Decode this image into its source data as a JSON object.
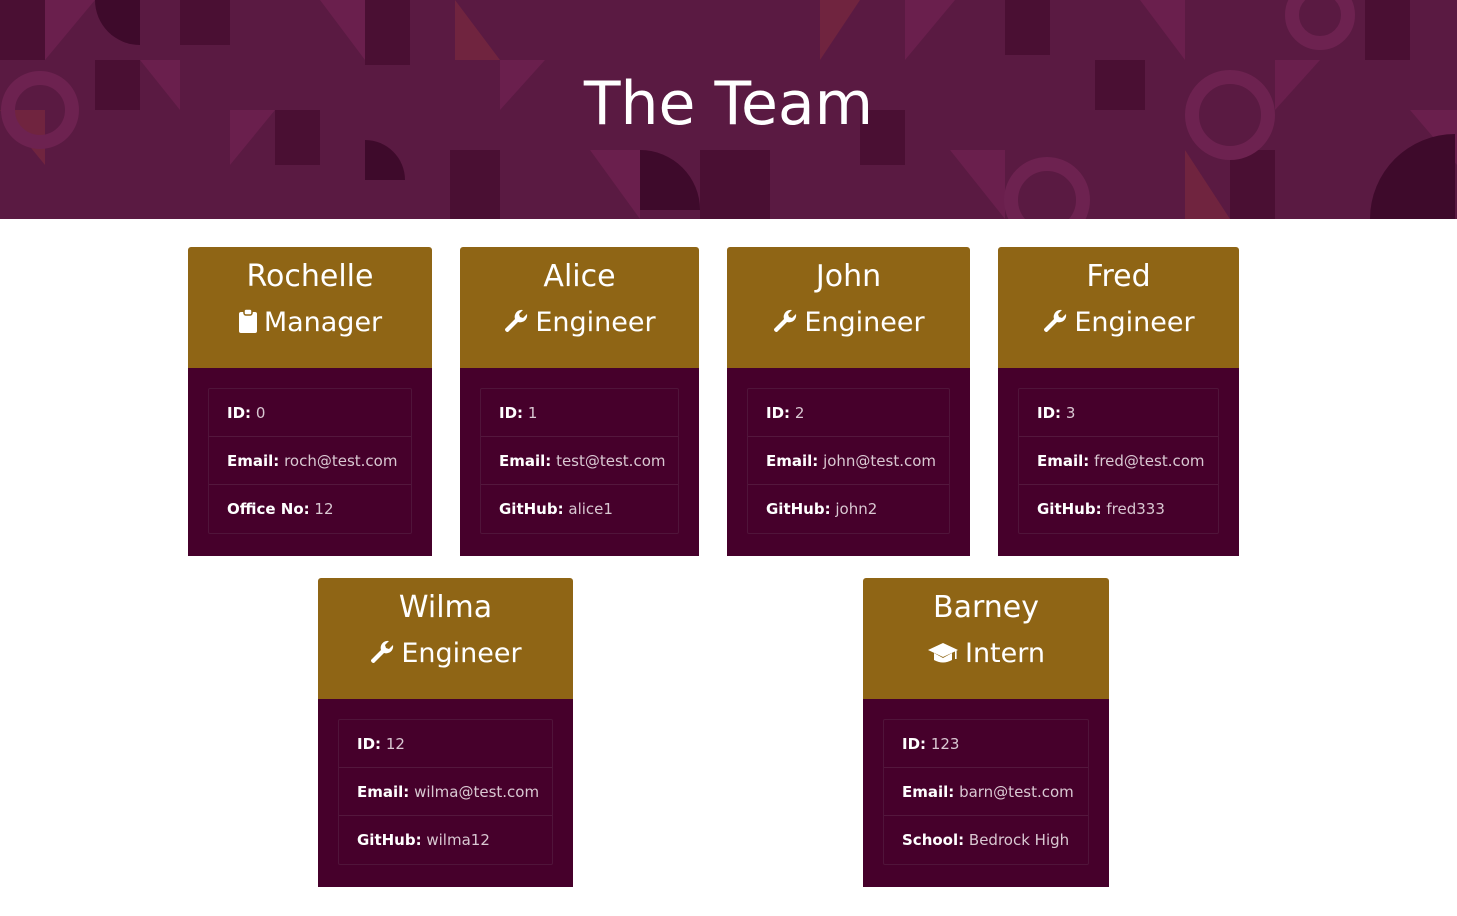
{
  "header": {
    "title": "The Team"
  },
  "colors": {
    "card_header": "#8f6515",
    "card_body": "#46002b",
    "banner": "#5a1a42"
  },
  "cards": [
    {
      "name": "Rochelle",
      "role": "Manager",
      "icon": "clipboard-icon",
      "fields": [
        {
          "label": "ID:",
          "value": "0"
        },
        {
          "label": "Email:",
          "value": "roch@test.com"
        },
        {
          "label": "Office No:",
          "value": "12"
        }
      ]
    },
    {
      "name": "Alice",
      "role": "Engineer",
      "icon": "wrench-icon",
      "fields": [
        {
          "label": "ID:",
          "value": "1"
        },
        {
          "label": "Email:",
          "value": "test@test.com"
        },
        {
          "label": "GitHub:",
          "value": "alice1"
        }
      ]
    },
    {
      "name": "John",
      "role": "Engineer",
      "icon": "wrench-icon",
      "fields": [
        {
          "label": "ID:",
          "value": "2"
        },
        {
          "label": "Email:",
          "value": "john@test.com"
        },
        {
          "label": "GitHub:",
          "value": "john2"
        }
      ]
    },
    {
      "name": "Fred",
      "role": "Engineer",
      "icon": "wrench-icon",
      "fields": [
        {
          "label": "ID:",
          "value": "3"
        },
        {
          "label": "Email:",
          "value": "fred@test.com"
        },
        {
          "label": "GitHub:",
          "value": "fred333"
        }
      ]
    },
    {
      "name": "Wilma",
      "role": "Engineer",
      "icon": "wrench-icon",
      "fields": [
        {
          "label": "ID:",
          "value": "12"
        },
        {
          "label": "Email:",
          "value": "wilma@test.com"
        },
        {
          "label": "GitHub:",
          "value": "wilma12"
        }
      ]
    },
    {
      "name": "Barney",
      "role": "Intern",
      "icon": "graduation-cap-icon",
      "fields": [
        {
          "label": "ID:",
          "value": "123"
        },
        {
          "label": "Email:",
          "value": "barn@test.com"
        },
        {
          "label": "School:",
          "value": "Bedrock High"
        }
      ]
    }
  ]
}
